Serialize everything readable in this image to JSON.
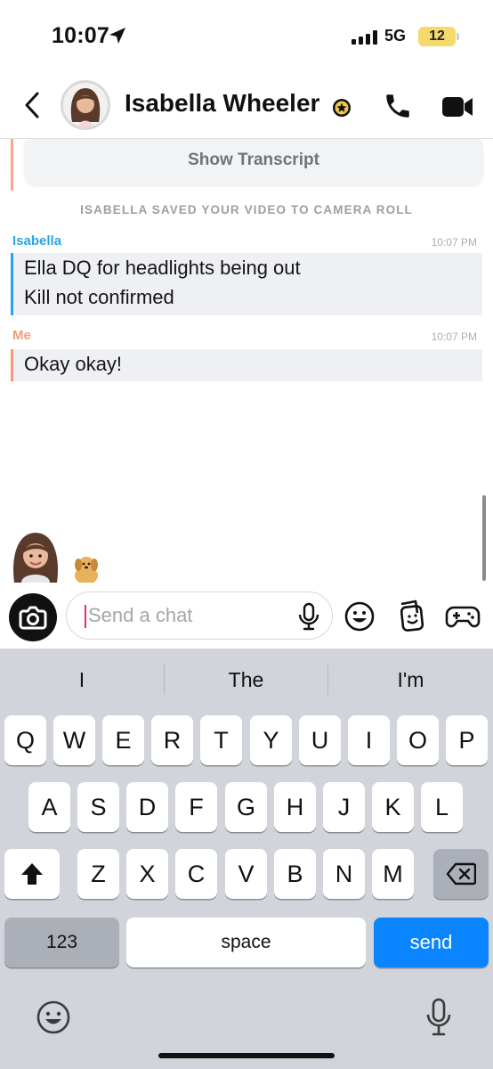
{
  "status_bar": {
    "time": "10:07",
    "network": "5G",
    "battery": "12"
  },
  "header": {
    "contact_name": "Isabella Wheeler"
  },
  "chat": {
    "transcript_button": "Show Transcript",
    "system_note": "ISABELLA SAVED YOUR VIDEO TO CAMERA ROLL",
    "messages": [
      {
        "sender": "Isabella",
        "time": "10:07 PM",
        "lines": [
          "Ella DQ for headlights being out",
          "Kill not confirmed"
        ]
      },
      {
        "sender": "Me",
        "time": "10:07 PM",
        "lines": [
          "Okay okay!"
        ]
      }
    ]
  },
  "input": {
    "placeholder": "Send a chat"
  },
  "keyboard": {
    "suggestions": [
      "I",
      "The",
      "I'm"
    ],
    "row1": [
      "Q",
      "W",
      "E",
      "R",
      "T",
      "Y",
      "U",
      "I",
      "O",
      "P"
    ],
    "row2": [
      "A",
      "S",
      "D",
      "F",
      "G",
      "H",
      "J",
      "K",
      "L"
    ],
    "row3": [
      "Z",
      "X",
      "C",
      "V",
      "B",
      "N",
      "M"
    ],
    "numbers_key": "123",
    "space_key": "space",
    "send_key": "send"
  },
  "colors": {
    "isabella": "#2aa6e6",
    "me": "#f59b7c",
    "send_key": "#0a84ff",
    "battery": "#f5d96b"
  },
  "icons": {
    "status": [
      "location-arrow-icon",
      "signal-icon"
    ],
    "header": [
      "back-chevron-icon",
      "avatar",
      "star-badge-icon",
      "phone-icon",
      "video-icon"
    ],
    "input": [
      "camera-icon",
      "microphone-icon",
      "emoji-icon",
      "sticker-icon",
      "game-controller-icon"
    ],
    "keyboard": [
      "shift-icon",
      "backspace-icon",
      "emoji-icon",
      "dictation-mic-icon"
    ]
  }
}
